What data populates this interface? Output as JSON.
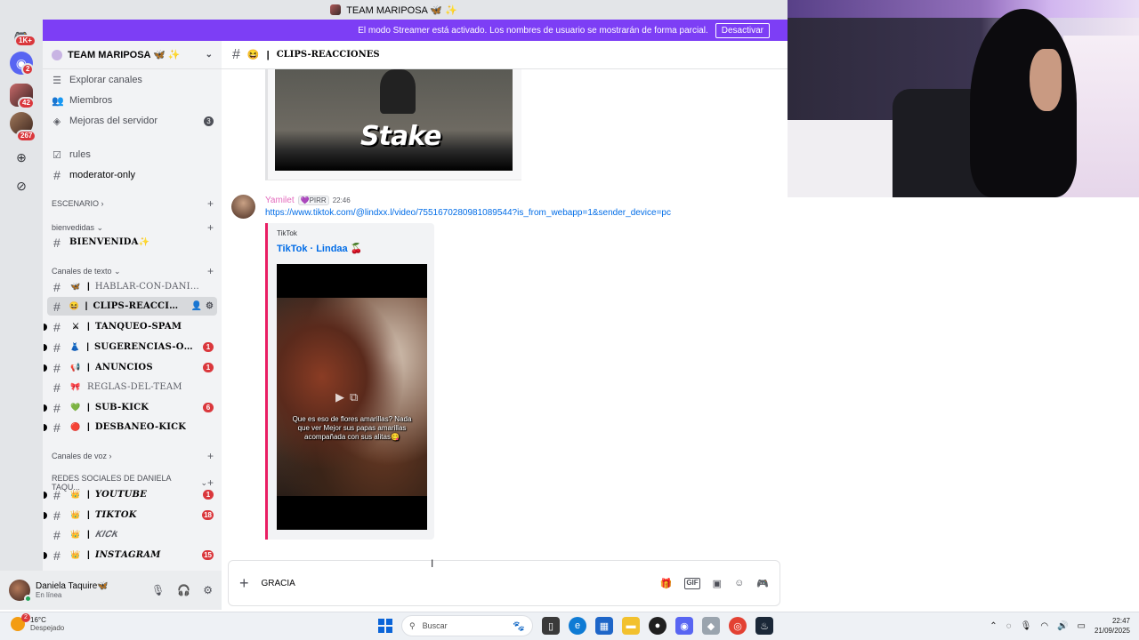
{
  "window": {
    "title": "TEAM MARIPOSA 🦋 ✨"
  },
  "banner": {
    "text": "El modo Streamer está activado. Los nombres de usuario se mostrarán de forma parcial.",
    "button": "Desactivar"
  },
  "rail": {
    "badges": [
      "1K+",
      "2",
      "42",
      "267"
    ]
  },
  "server": {
    "name": "TEAM MARIPOSA 🦋 ✨"
  },
  "sidebar": {
    "top_items": [
      {
        "label": "Explorar canales"
      },
      {
        "label": "Miembros"
      },
      {
        "label": "Mejoras del servidor",
        "count": "3"
      }
    ],
    "rules": "rules",
    "moderator": "moderator-only",
    "cat_escenario": "ESCENARIO",
    "cat_bienvenidas": "bienvedidas",
    "bienvenida": "BIENVENIDA✨",
    "cat_texto": "Canales de texto",
    "channels": [
      {
        "emoji": "🦋",
        "name": "HABLAR-CON-DANI 😻",
        "badge": ""
      },
      {
        "emoji": "😆",
        "name": "CLIPS-REACCION...",
        "badge": ""
      },
      {
        "emoji": "⚔",
        "name": "TANQUEO-SPAM",
        "badge": ""
      },
      {
        "emoji": "👗",
        "name": "SUGERENCIAS-OU...",
        "badge": "1"
      },
      {
        "emoji": "📢",
        "name": "ANUNCIOS",
        "badge": "1"
      },
      {
        "emoji": "🎀",
        "name": "REGLAS-DEL-TEAM",
        "badge": ""
      },
      {
        "emoji": "💚",
        "name": "SUB-KICK",
        "badge": "6"
      },
      {
        "emoji": "🔴",
        "name": "DESBANEO-KICK",
        "badge": ""
      }
    ],
    "cat_voz": "Canales de voz",
    "cat_redes": "REDES SOCIALES DE DANIELA TAQU...",
    "social": [
      {
        "emoji": "👑",
        "name": "𝒀𝑶𝑼𝑻𝑼𝑩𝑬",
        "badge": "1"
      },
      {
        "emoji": "👑",
        "name": "𝑻𝑰𝑲𝑻𝑶𝑲",
        "badge": "18"
      },
      {
        "emoji": "👑",
        "name": "𝑲𝑰𝑪𝑲",
        "badge": ""
      },
      {
        "emoji": "👑",
        "name": "𝑰𝑵𝑺𝑻𝑨𝑮𝑹𝑨𝑴",
        "badge": "15"
      }
    ]
  },
  "user": {
    "name": "Daniela Taquire🦋",
    "status": "En línea"
  },
  "chat": {
    "channel": "CLIPS-REACCIONES",
    "channel_emoji": "😆",
    "embed_top_text": "Stake",
    "message": {
      "author": "Yamilet",
      "tag": "💜PIRR",
      "time": "22:46",
      "link": "https://www.tiktok.com/@lindxx.l/video/7551670280981089544?is_from_webapp=1&sender_device=pc",
      "embed_provider": "TikTok",
      "embed_title": "TikTok · Lindaa 🍒",
      "caption": "Que es eso de flores amarillas? Nada que ver Mejor sus papas amarillas acompañada con sus alitas😋"
    }
  },
  "composer": {
    "value": "GRACIA"
  },
  "taskbar": {
    "temp": "16°C",
    "weather": "Despejado",
    "weather_badge": "2",
    "search": "Buscar",
    "time": "22:47",
    "date": "21/09/2025"
  },
  "colors": {
    "accent": "#7d3ef5",
    "link": "#006ce7",
    "mention": "#da373c",
    "tiktok_bar": "#e91e63"
  }
}
